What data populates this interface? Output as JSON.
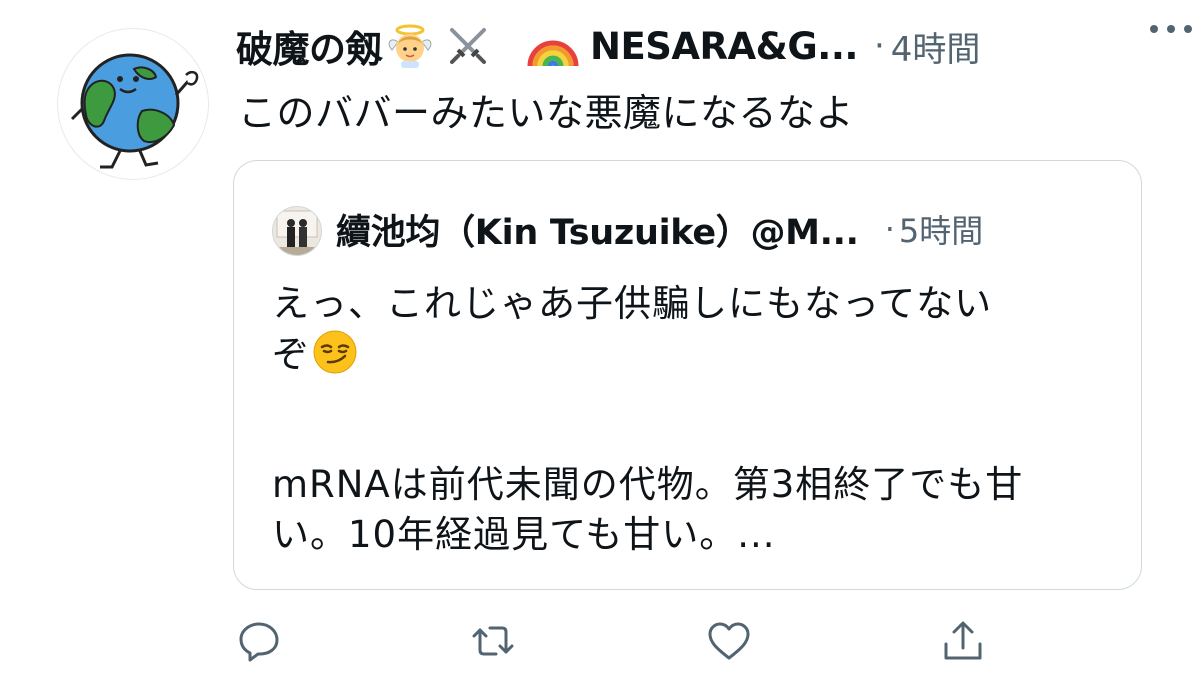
{
  "tweet": {
    "display_name": "破魔の剱",
    "name_emojis": [
      "baby-angel-emoji",
      "crossed-swords-emoji"
    ],
    "handle_emoji": "rainbow-emoji",
    "handle": "NESARA&G...",
    "dot": "·",
    "time": "4時間",
    "text": "このババーみたいな悪魔になるなよ"
  },
  "quote": {
    "name": "續池均（Kin Tsuzuike）@M...",
    "dot": "·",
    "time": "5時間",
    "line1": "えっ、これじゃあ子供騙しにもなってない",
    "line2": "ぞ",
    "line2_emoji": "smirking-face-emoji",
    "line3": "mRNAは前代未聞の代物。第3相終了でも甘",
    "line4": "い。10年経過見ても甘い。..."
  },
  "actions": [
    "reply-icon",
    "retweet-icon",
    "like-icon",
    "share-icon"
  ],
  "colors": {
    "text": "#0f1419",
    "secondary": "#536471",
    "border": "#cfd9de",
    "earth_blue": "#4a9ee0",
    "earth_green": "#3d9a3f"
  }
}
